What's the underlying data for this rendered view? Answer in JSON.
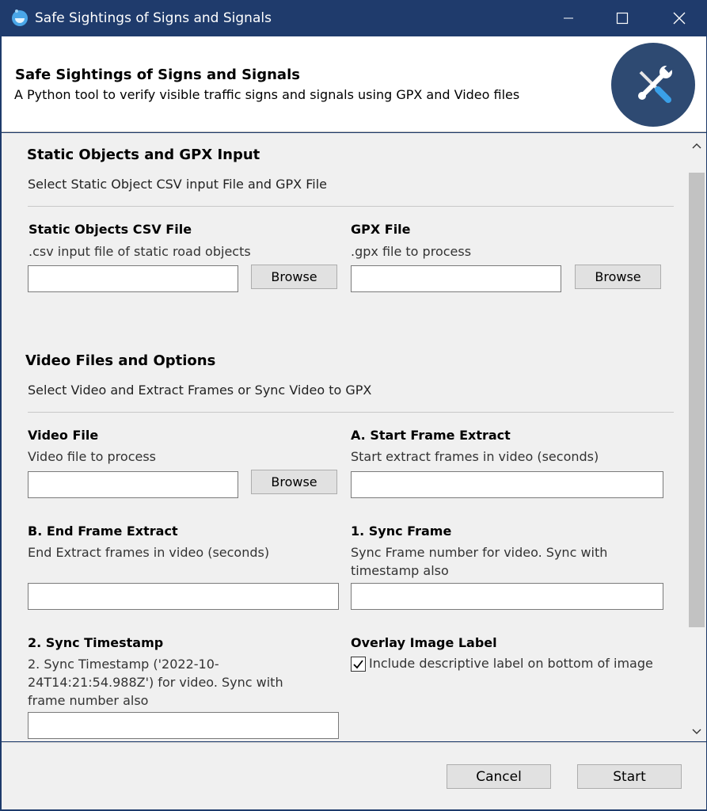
{
  "window": {
    "title": "Safe Sightings of Signs and Signals",
    "icon": "app-logo-icon",
    "controls": [
      "minimize-icon",
      "maximize-icon",
      "close-icon"
    ]
  },
  "header": {
    "title": "Safe Sightings of Signs and Signals",
    "subtitle": "A Python tool to verify visible traffic signs and signals using GPX and Video files",
    "logo_icon": "wrench-screwdriver-icon"
  },
  "sections": {
    "static": {
      "title": "Static Objects and GPX Input",
      "description": "Select Static Object CSV input File and GPX File"
    },
    "video": {
      "title": "Video Files and Options",
      "description": "Select Video and Extract Frames or Sync Video to GPX"
    }
  },
  "fields": {
    "csv_file": {
      "label": "Static Objects CSV File",
      "help": ".csv input file of static road objects",
      "value": "",
      "browse": "Browse"
    },
    "gpx_file": {
      "label": "GPX File",
      "help": ".gpx file to process",
      "value": "",
      "browse": "Browse"
    },
    "video_file": {
      "label": "Video File",
      "help": "Video file to process",
      "value": "",
      "browse": "Browse"
    },
    "start_frame": {
      "label": "A. Start Frame Extract",
      "help": "Start extract frames in video (seconds)",
      "value": ""
    },
    "end_frame": {
      "label": "B. End Frame Extract",
      "help": "End Extract frames in video (seconds)",
      "value": ""
    },
    "sync_frame": {
      "label": "1. Sync Frame",
      "help": "Sync Frame number for video. Sync with timestamp also",
      "value": ""
    },
    "sync_timestamp": {
      "label": "2. Sync Timestamp",
      "help": "2. Sync Timestamp ('2022-10-24T14:21:54.988Z') for video. Sync with frame number also",
      "value": ""
    },
    "overlay": {
      "label": "Overlay Image Label",
      "checkbox_label": "Include descriptive label on bottom of image",
      "checked": true
    }
  },
  "footer": {
    "cancel": "Cancel",
    "start": "Start"
  },
  "colors": {
    "titlebar": "#1f3b6c",
    "logo_bg": "#2e4a72",
    "logo_accent": "#3aa0e8"
  }
}
